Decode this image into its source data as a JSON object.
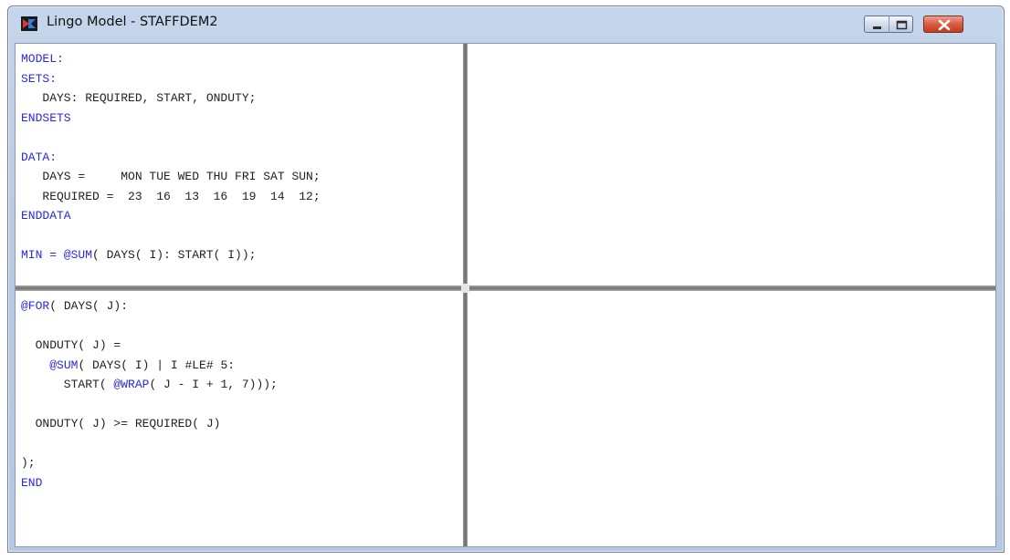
{
  "window": {
    "title": "Lingo Model - STAFFDEM2",
    "controls": {
      "minimize_icon": "minimize-icon",
      "maximize_icon": "maximize-icon",
      "close_icon": "close-icon"
    }
  },
  "colors": {
    "keyword": "#2a2ae0",
    "text": "#222222",
    "close_button": "#c53b1f"
  },
  "editor": {
    "top_left_lines": [
      {
        "kw": "MODEL:",
        "text": ""
      },
      {
        "kw": "SETS:",
        "text": ""
      },
      {
        "kw": "",
        "text": "   DAYS: REQUIRED, START, ONDUTY;"
      },
      {
        "kw": "ENDSETS",
        "text": ""
      },
      {
        "kw": "",
        "text": ""
      },
      {
        "kw": "DATA:",
        "text": ""
      },
      {
        "kw": "",
        "text": "   DAYS =     MON TUE WED THU FRI SAT SUN;"
      },
      {
        "kw": "",
        "text": "   REQUIRED =  23  16  13  16  19  14  12;"
      },
      {
        "kw": "ENDDATA",
        "text": ""
      },
      {
        "kw": "",
        "text": ""
      },
      {
        "kw": "",
        "text": "",
        "segments": [
          {
            "t": "MIN = ",
            "k": true
          },
          {
            "t": "@SUM",
            "k": true
          },
          {
            "t": "( DAYS( I): START( I));",
            "k": false
          }
        ]
      }
    ],
    "bottom_left_lines": [
      {
        "segments": [
          {
            "t": "@FOR",
            "k": true
          },
          {
            "t": "( DAYS( J):",
            "k": false
          }
        ]
      },
      {
        "segments": [
          {
            "t": "",
            "k": false
          }
        ]
      },
      {
        "segments": [
          {
            "t": "  ONDUTY( J) =",
            "k": false
          }
        ]
      },
      {
        "segments": [
          {
            "t": "    ",
            "k": false
          },
          {
            "t": "@SUM",
            "k": true
          },
          {
            "t": "( DAYS( I) | I #LE# 5:",
            "k": false
          }
        ]
      },
      {
        "segments": [
          {
            "t": "      START( ",
            "k": false
          },
          {
            "t": "@WRAP",
            "k": true
          },
          {
            "t": "( J - I + 1, 7)));",
            "k": false
          }
        ]
      },
      {
        "segments": [
          {
            "t": "",
            "k": false
          }
        ]
      },
      {
        "segments": [
          {
            "t": "  ONDUTY( J) >= REQUIRED( J)",
            "k": false
          }
        ]
      },
      {
        "segments": [
          {
            "t": "",
            "k": false
          }
        ]
      },
      {
        "segments": [
          {
            "t": ");",
            "k": false
          }
        ]
      },
      {
        "segments": [
          {
            "t": "END",
            "k": true
          }
        ]
      }
    ]
  }
}
